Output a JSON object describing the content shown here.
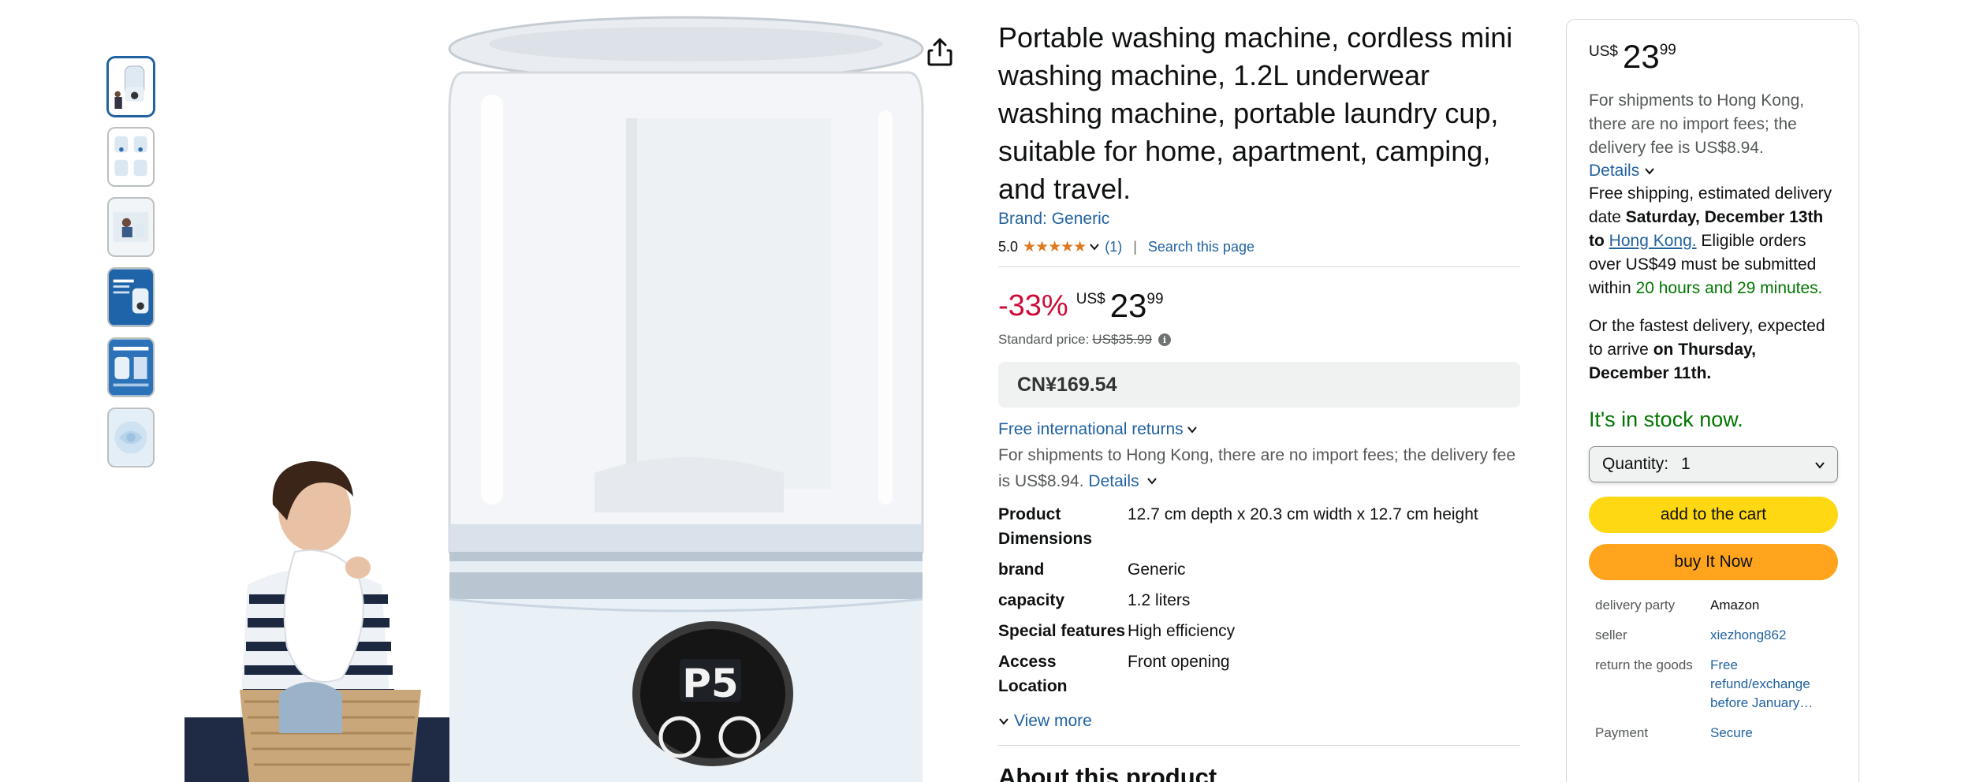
{
  "product": {
    "title": "Portable washing machine, cordless mini washing machine, 1.2L underwear washing machine, portable laundry cup, suitable for home, apartment, camping, and travel.",
    "brand": "Brand: Generic",
    "rating_value": "5.0",
    "rating_stars": "★★★★★",
    "rating_count": "(1)",
    "separator": "|",
    "search_page": "Search this page"
  },
  "price": {
    "discount": "-33%",
    "currency": "US$",
    "whole": "23",
    "fraction": "99",
    "standard_label": "Standard price:",
    "standard_value": "US$35.99",
    "info_icon": "i",
    "cny": "CN¥169.54"
  },
  "shipping": {
    "returns": "Free international returns",
    "note": "For shipments to Hong Kong, there are no import fees; the delivery fee is US$8.94.",
    "details": "Details"
  },
  "specs": [
    {
      "key": "Product Dimensions",
      "value": "12.7 cm depth x 20.3 cm width x 12.7 cm height"
    },
    {
      "key": "brand",
      "value": "Generic"
    },
    {
      "key": "capacity",
      "value": "1.2 liters"
    },
    {
      "key": "Special features",
      "value": "High efficiency"
    },
    {
      "key": "Access Location",
      "value": "Front opening"
    }
  ],
  "view_more": "View more",
  "about_heading": "About this product",
  "image_display": {
    "screen_text": "P5"
  },
  "buybox": {
    "currency": "US$",
    "whole": "23",
    "fraction": "99",
    "import_note": "For shipments to Hong Kong, there are no import fees; the delivery fee is US$8.94.",
    "details": "Details",
    "ship_pre": "Free shipping, estimated delivery date ",
    "ship_date": "Saturday, December 13th to",
    "ship_place": "Hong Kong.",
    "orders_pre": " Eligible orders over US$49 must be submitted within ",
    "orders_time": "20 hours and 29 minutes.",
    "fast_pre": "Or the fastest delivery, expected to arrive ",
    "fast_date": "on Thursday, December 11th.",
    "in_stock": "It's in stock now.",
    "qty_label": "Quantity:",
    "qty_value": "1",
    "add_cart": "add to the cart",
    "buy_now": "buy It Now",
    "meta": [
      {
        "key": "delivery party",
        "value": "Amazon",
        "link": false
      },
      {
        "key": "seller",
        "value": "xiezhong862",
        "link": true
      },
      {
        "key": "return the goods",
        "value": "Free refund/exchange before January…",
        "link": true
      },
      {
        "key": "Payment",
        "value": "Secure",
        "link": true
      }
    ]
  },
  "colors": {
    "link": "#2162a1",
    "discount": "#cc0c39",
    "green": "#007600",
    "cart_button": "#ffd814",
    "buy_button": "#ffa41c",
    "star": "#de7921"
  },
  "icons": [
    "share-icon",
    "chevron-down-icon",
    "star-icon",
    "info-icon"
  ]
}
